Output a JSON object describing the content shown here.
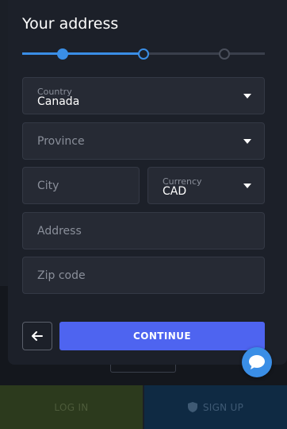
{
  "modal": {
    "title": "Your address",
    "progress": {
      "current_step": 2,
      "total_steps": 3,
      "completed_fraction": 0.5
    }
  },
  "form": {
    "country": {
      "label": "Country",
      "value": "Canada"
    },
    "province": {
      "placeholder": "Province"
    },
    "city": {
      "placeholder": "City"
    },
    "currency": {
      "label": "Currency",
      "value": "CAD"
    },
    "address": {
      "placeholder": "Address"
    },
    "zip": {
      "placeholder": "Zip code"
    }
  },
  "actions": {
    "back_icon": "arrow-left-icon",
    "continue_label": "CONTINUE"
  },
  "chat": {
    "icon": "chat-bubble-icon"
  },
  "bottom_bar": {
    "login_label": "LOG IN",
    "signup_label": "SIGN UP",
    "signup_icon": "shield-icon"
  },
  "colors": {
    "accent": "#3a8ee6",
    "primary_button": "#4e64f0",
    "modal_bg": "#1c2029",
    "field_bg": "#262a34"
  }
}
